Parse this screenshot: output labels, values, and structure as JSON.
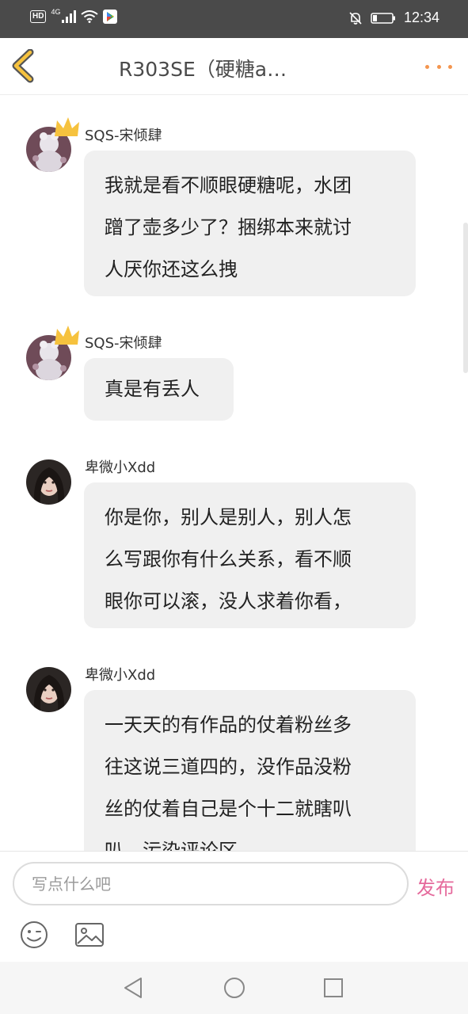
{
  "status_bar": {
    "hd_label": "HD",
    "network_type": "4G",
    "time": "12:34",
    "icons": [
      "signal-icon",
      "wifi-icon",
      "play-store-icon",
      "mute-bell-icon",
      "battery-icon"
    ]
  },
  "header": {
    "title": "R303SE（硬糖a…",
    "back_icon": "chevron-left-icon",
    "more_icon": "more-dots-icon"
  },
  "messages": [
    {
      "username": "SQS-宋倾肆",
      "has_crown": true,
      "lines": [
        "我就是看不顺眼硬糖呢，水团",
        "蹭了壶多少了？捆绑本来就讨",
        "人厌你还这么拽"
      ]
    },
    {
      "username": "SQS-宋倾肆",
      "has_crown": true,
      "lines": [
        "真是有丢人"
      ]
    },
    {
      "username": "卑微小Xdd",
      "has_crown": false,
      "lines": [
        "你是你，别人是别人，别人怎",
        "么写跟你有什么关系，看不顺",
        "眼你可以滚，没人求着你看，"
      ]
    },
    {
      "username": "卑微小Xdd",
      "has_crown": false,
      "lines": [
        "一天天的有作品的仗着粉丝多",
        "往这说三道四的，没作品没粉",
        "丝的仗着自己是个十二就瞎叭",
        "叭，污染评论区"
      ]
    }
  ],
  "composer": {
    "input_placeholder": "写点什么吧",
    "input_value": "",
    "publish_label": "发布",
    "emoji_icon": "emoji-icon",
    "image_icon": "image-icon"
  },
  "nav_bar": {
    "icons": [
      "back-triangle-icon",
      "home-circle-icon",
      "recents-square-icon"
    ]
  },
  "colors": {
    "status_bar_bg": "#4a4a4a",
    "accent_more": "#f4954e",
    "accent_publish": "#e56a9c",
    "bubble_bg": "#f0f0f0",
    "back_chevron_fill": "#f6c23e"
  }
}
